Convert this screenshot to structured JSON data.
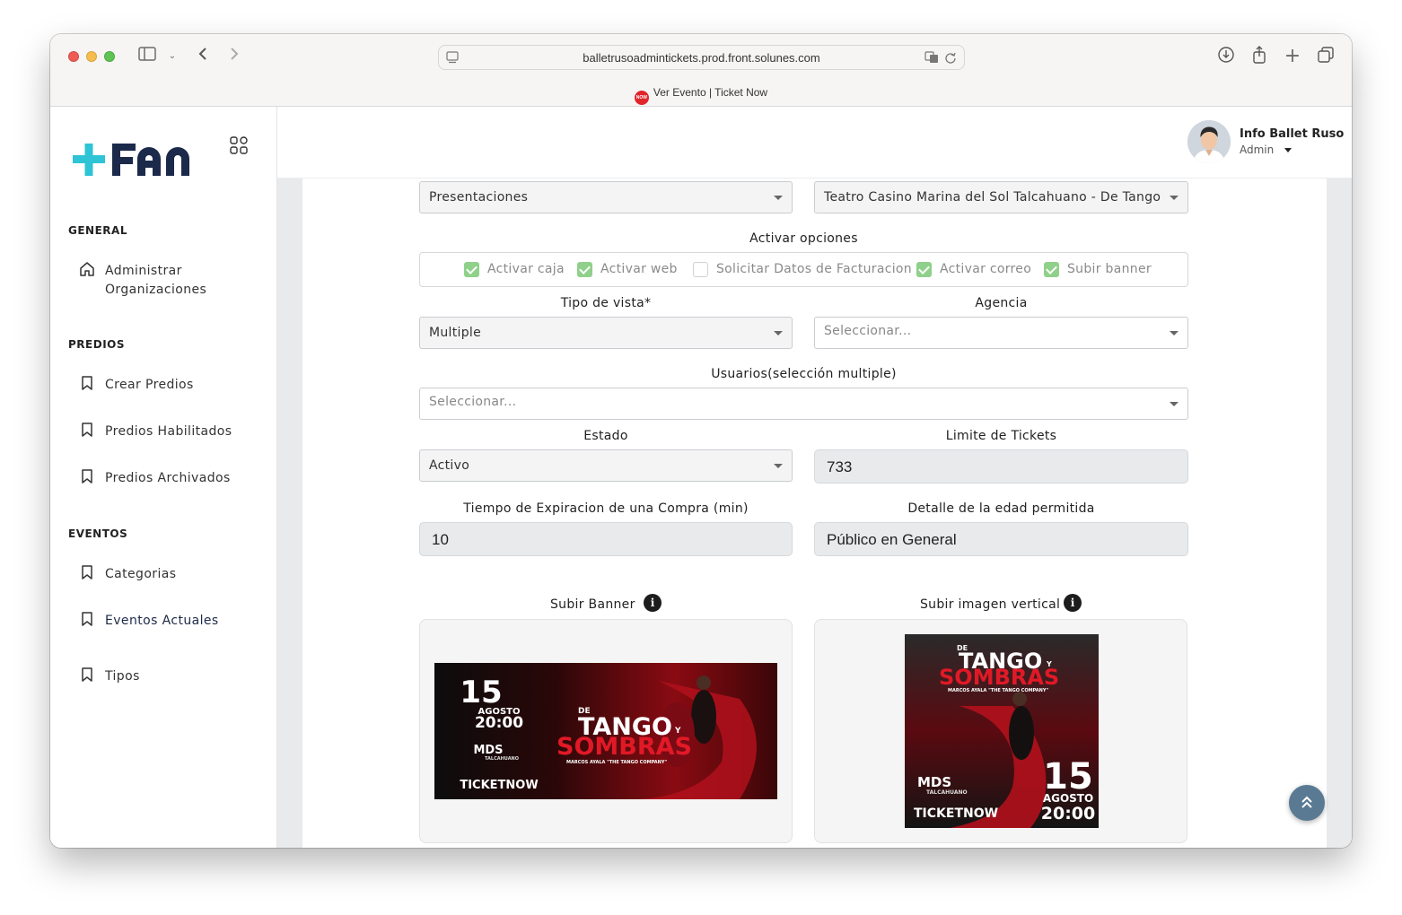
{
  "browser": {
    "url": "balletrusoadmintickets.prod.front.solunes.com",
    "tab_title": "Ver Evento | Ticket Now",
    "favicon_text": "NOW"
  },
  "sidebar": {
    "sections": [
      {
        "title": "GENERAL",
        "items": [
          {
            "label_line1": "Administrar",
            "label_line2": "Organizaciones",
            "icon": "home-icon"
          }
        ]
      },
      {
        "title": "PREDIOS",
        "items": [
          {
            "label": "Crear Predios",
            "icon": "bookmark-icon"
          },
          {
            "label": "Predios Habilitados",
            "icon": "bookmark-icon"
          },
          {
            "label": "Predios Archivados",
            "icon": "bookmark-icon"
          }
        ]
      },
      {
        "title": "EVENTOS",
        "items": [
          {
            "label": "Categorias",
            "icon": "bookmark-icon"
          },
          {
            "label": "Eventos Actuales",
            "icon": "bookmark-icon"
          },
          {
            "label": "Tipos",
            "icon": "bookmark-icon"
          }
        ]
      }
    ]
  },
  "header": {
    "user_name": "Info Ballet Ruso",
    "user_role": "Admin"
  },
  "form": {
    "top_select_left": "Presentaciones",
    "top_select_right": "Teatro Casino Marina del Sol Talcahuano - De Tango y Sombras",
    "options_title": "Activar opciones",
    "options": [
      {
        "label": "Activar caja",
        "checked": true
      },
      {
        "label": "Activar web",
        "checked": true
      },
      {
        "label": "Solicitar Datos de Facturacion",
        "checked": false
      },
      {
        "label": "Activar correo",
        "checked": true
      },
      {
        "label": "Subir banner",
        "checked": true
      }
    ],
    "tipo_vista": {
      "label": "Tipo de vista*",
      "value": "Multiple"
    },
    "agencia": {
      "label": "Agencia",
      "placeholder": "Seleccionar..."
    },
    "usuarios": {
      "label": "Usuarios(selección multiple)",
      "placeholder": "Seleccionar..."
    },
    "estado": {
      "label": "Estado",
      "value": "Activo"
    },
    "limite": {
      "label": "Limite de Tickets",
      "value": "733"
    },
    "tiempo": {
      "label": "Tiempo de Expiracion de una Compra (min)",
      "value": "10"
    },
    "edad": {
      "label": "Detalle de la edad permitida",
      "value": "Público en General"
    },
    "banner": {
      "label": "Subir Banner"
    },
    "vertical": {
      "label": "Subir imagen vertical"
    }
  },
  "poster": {
    "day": "15",
    "month": "AGOSTO",
    "time": "20:00",
    "title_small": "DE",
    "title_main": "TANGO",
    "title_y": "Y",
    "title_second": "SOMBRAS",
    "subtitle": "MARCOS AYALA \"THE TANGO COMPANY\"",
    "venue": "MDS",
    "venue_city": "TALCAHUANO",
    "brand": "TICKETNOW"
  },
  "colors": {
    "brand_cyan": "#2ec4d6",
    "brand_navy": "#1b2a4a",
    "checkbox_green": "#8fd08a",
    "poster_red": "#c0121c"
  }
}
